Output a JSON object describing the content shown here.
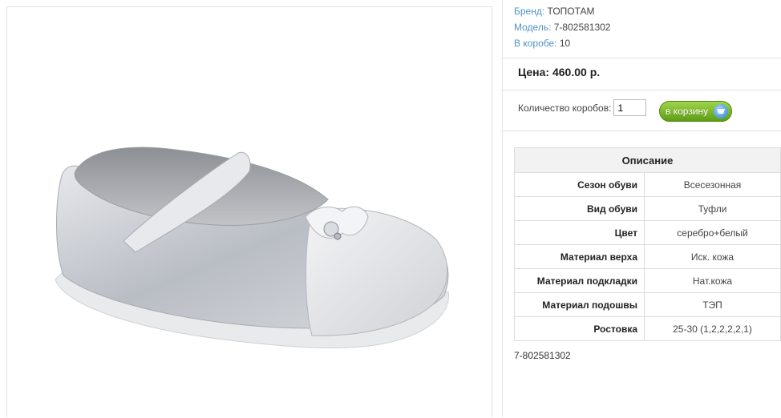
{
  "product": {
    "image_alt": "silver girls shoe with strap and bow"
  },
  "meta": [
    {
      "label": "Бренд:",
      "value": "ТОПОТАМ"
    },
    {
      "label": "Модель:",
      "value": "7-802581302"
    },
    {
      "label": "В коробе:",
      "value": "10"
    }
  ],
  "price": {
    "text": "Цена: 460.00 р."
  },
  "quantity": {
    "label": "Количество коробов:",
    "value": "1"
  },
  "cart_button": {
    "label": "в корзину",
    "icon": "cart-icon"
  },
  "spec": {
    "header": "Описание",
    "rows": [
      {
        "label": "Сезон обуви",
        "value": "Всесезонная"
      },
      {
        "label": "Вид обуви",
        "value": "Туфли"
      },
      {
        "label": "Цвет",
        "value": "серебро+белый"
      },
      {
        "label": "Материал верха",
        "value": "Иск. кожа"
      },
      {
        "label": "Материал подкладки",
        "value": "Нат.кожа"
      },
      {
        "label": "Материал подошвы",
        "value": "ТЭП"
      },
      {
        "label": "Ростовка",
        "value": "25-30 (1,2,2,2,2,1)"
      }
    ]
  },
  "footer_code": "7-802581302",
  "colors": {
    "link": "#4f93c7",
    "button_green": "#6aab1c"
  }
}
